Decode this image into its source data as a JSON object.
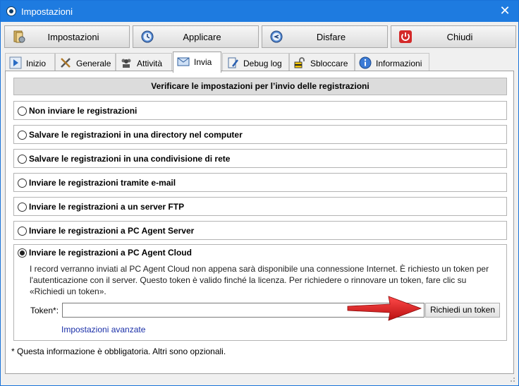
{
  "window": {
    "title": "Impostazioni",
    "close_glyph": "✕"
  },
  "toolbar": {
    "impostazioni": "Impostazioni",
    "applicare": "Applicare",
    "disfare": "Disfare",
    "chiudi": "Chiudi"
  },
  "tabs": [
    {
      "label": "Inizio",
      "icon": "play-icon"
    },
    {
      "label": "Generale",
      "icon": "tools-icon"
    },
    {
      "label": "Attività",
      "icon": "users-icon"
    },
    {
      "label": "Invia",
      "icon": "envelope-icon",
      "active": true
    },
    {
      "label": "Debug log",
      "icon": "document-pen-icon"
    },
    {
      "label": "Sbloccare",
      "icon": "unlock-icon"
    },
    {
      "label": "Informazioni",
      "icon": "info-icon"
    }
  ],
  "panel": {
    "header": "Verificare le impostazioni per l’invio delle registrazioni",
    "options": [
      "Non inviare le registrazioni",
      "Salvare le registrazioni in una directory nel computer",
      "Salvare le registrazioni in una condivisione di rete",
      "Inviare le registrazioni tramite e-mail",
      "Inviare le registrazioni a un server FTP",
      "Inviare le registrazioni a PC Agent Server"
    ],
    "cloud": {
      "label": "Inviare le registrazioni a PC Agent Cloud",
      "selected": true,
      "description": "I record verranno inviati al PC Agent Cloud non appena sarà disponibile una connessione Internet. È richiesto un token per l'autenticazione con il server. Questo token è valido finché la licenza. Per richiedere o rinnovare un token, fare clic su «Richiedi un token».",
      "token_label": "Token*:",
      "token_value": "",
      "token_button": "Richiedi un token",
      "advanced_link": "Impostazioni avanzate"
    },
    "footnote": "* Questa informazione è obbligatoria. Altri sono opzionali."
  },
  "colors": {
    "titlebar": "#1e7be0",
    "arrow": "#e01b1b",
    "link": "#1a2fa8"
  }
}
